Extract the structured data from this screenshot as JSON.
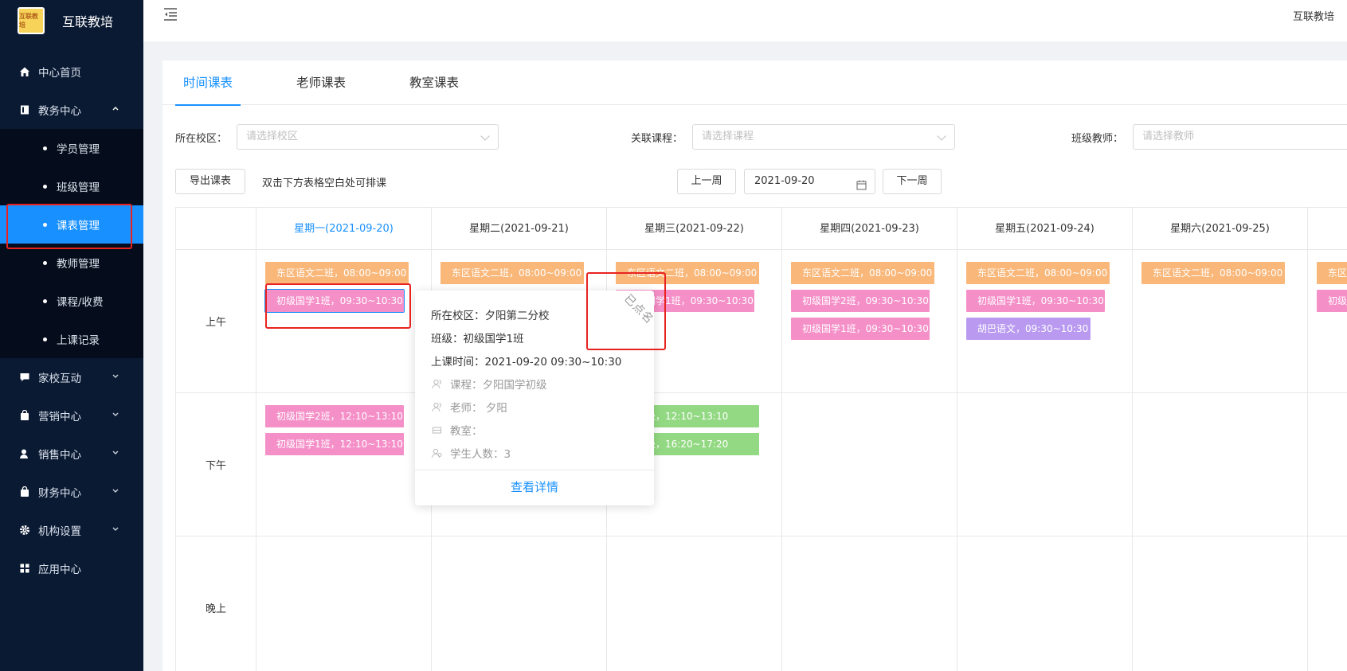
{
  "app": {
    "name": "互联教培",
    "logo_text": "互联教培"
  },
  "header": {
    "user": "互联教培"
  },
  "sidebar": {
    "items": [
      {
        "label": "中心首页",
        "icon": "home-icon"
      },
      {
        "label": "教务中心",
        "icon": "book-icon",
        "expanded": true
      },
      {
        "label": "家校互动",
        "icon": "chat-icon"
      },
      {
        "label": "营销中心",
        "icon": "bag-icon"
      },
      {
        "label": "销售中心",
        "icon": "user-icon"
      },
      {
        "label": "财务中心",
        "icon": "wallet-icon"
      },
      {
        "label": "机构设置",
        "icon": "gear-icon"
      },
      {
        "label": "应用中心",
        "icon": "grid-icon"
      }
    ],
    "subitems": [
      "学员管理",
      "班级管理",
      "课表管理",
      "教师管理",
      "课程/收费",
      "上课记录"
    ],
    "active_subitem": "课表管理"
  },
  "tabs": [
    "时间课表",
    "老师课表",
    "教室课表"
  ],
  "active_tab": "时间课表",
  "filters": {
    "campus": {
      "label": "所在校区：",
      "placeholder": "请选择校区"
    },
    "course": {
      "label": "关联课程：",
      "placeholder": "请选择课程"
    },
    "teacher": {
      "label": "班级教师：",
      "placeholder": "请选择教师"
    }
  },
  "actions": {
    "export": "导出课表",
    "hint": "双击下方表格空白处可排课",
    "prev_week": "上一周",
    "date": "2021-09-20",
    "next_week": "下一周"
  },
  "schedule": {
    "days": [
      "星期一(2021-09-20)",
      "星期二(2021-09-21)",
      "星期三(2021-09-22)",
      "星期四(2021-09-23)",
      "星期五(2021-09-24)",
      "星期六(2021-09-25)"
    ],
    "periods": [
      "上午",
      "下午",
      "晚上"
    ],
    "morning": {
      "mon": [
        "东区语文二班，08:00~09:00",
        "初级国学1班，09:30~10:30"
      ],
      "tue": [
        "东区语文二班，08:00~09:00"
      ],
      "wed": [
        "东区语文二班，08:00~09:00",
        "初级国学1班，09:30~10:30"
      ],
      "thu": [
        "东区语文二班，08:00~09:00",
        "初级国学2班，09:30~10:30",
        "初级国学1班，09:30~10:30"
      ],
      "fri": [
        "东区语文二班，08:00~09:00",
        "初级国学1班，09:30~10:30",
        "胡巴语文，09:30~10:30"
      ],
      "sat": [
        "东区语文二班，08:00~09:00"
      ],
      "sun": [
        "东区",
        "初级"
      ]
    },
    "afternoon": {
      "mon": [
        "初级国学2班，12:10~13:10",
        "初级国学1班，12:10~13:10"
      ],
      "wed": [
        "独班级，12:10~13:10",
        "独班级，16:20~17:20"
      ]
    }
  },
  "popover": {
    "campus": "所在校区：夕阳第二分校",
    "class": "班级：初级国学1班",
    "time": "上课时间：2021-09-20 09:30~10:30",
    "course": "课程：夕阳国学初级",
    "teacher": "老师： 夕阳",
    "room": "教室：",
    "students": "学生人数：3",
    "detail_link": "查看详情",
    "stamp": "已点名"
  },
  "colors": {
    "accent": "#1890ff",
    "sidebar": "#0b1a33",
    "orange": "#f9b77a",
    "pink": "#f58fc8",
    "purple": "#b99af0",
    "green": "#93d983",
    "highlight": "#e8231f"
  }
}
